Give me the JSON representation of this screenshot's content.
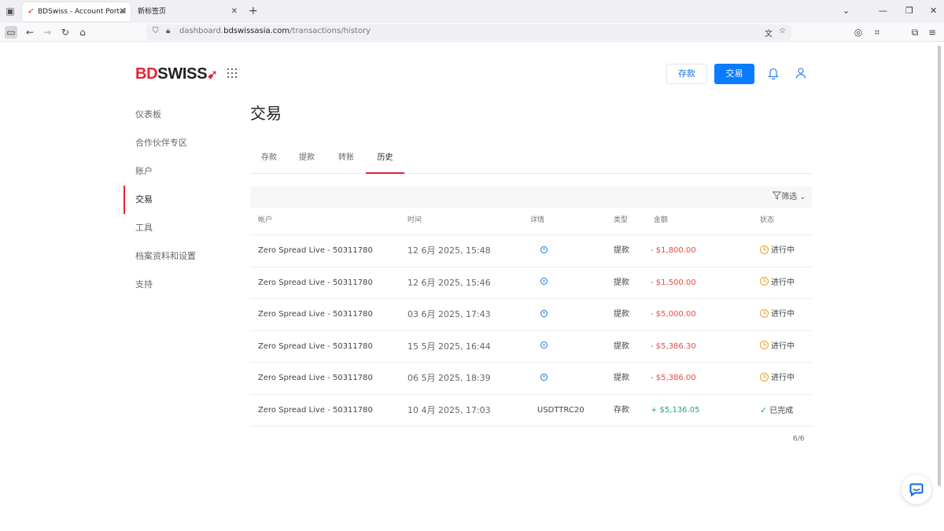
{
  "browser": {
    "tabs": [
      {
        "label": "BDSwiss - Account Portal",
        "active": true
      },
      {
        "label": "新标签页",
        "active": false
      }
    ],
    "url_prefix": "dashboard.",
    "url_domain": "bdswissasia.com",
    "url_path": "/transactions/history"
  },
  "brand": {
    "logo_bd": "BD",
    "logo_swiss": "SWISS",
    "accent_color": "#e52431"
  },
  "header": {
    "deposit_label": "存款",
    "trade_label": "交易"
  },
  "sidebar": {
    "items": [
      {
        "label": "仪表板",
        "active": false
      },
      {
        "label": "合作伙伴专区",
        "active": false
      },
      {
        "label": "账户",
        "active": false
      },
      {
        "label": "交易",
        "active": true
      },
      {
        "label": "工具",
        "active": false
      },
      {
        "label": "档案资料和设置",
        "active": false
      },
      {
        "label": "支持",
        "active": false
      }
    ]
  },
  "main": {
    "title": "交易",
    "tabs": [
      {
        "label": "存款",
        "active": false
      },
      {
        "label": "提款",
        "active": false
      },
      {
        "label": "转账",
        "active": false
      },
      {
        "label": "历史",
        "active": true
      }
    ],
    "filter_label": "筛选",
    "columns": [
      "帐户",
      "时间",
      "详情",
      "类型",
      "金额",
      "状态"
    ],
    "rows": [
      {
        "account": "Zero Spread Live - 50311780",
        "time": "12 6月 2025, 15:48",
        "details": "",
        "type": "提款",
        "amount": "- $1,800.00",
        "sign": "neg",
        "status": "进行中",
        "state": "pending"
      },
      {
        "account": "Zero Spread Live - 50311780",
        "time": "12 6月 2025, 15:46",
        "details": "",
        "type": "提款",
        "amount": "- $1,500.00",
        "sign": "neg",
        "status": "进行中",
        "state": "pending"
      },
      {
        "account": "Zero Spread Live - 50311780",
        "time": "03 6月 2025, 17:43",
        "details": "",
        "type": "提款",
        "amount": "- $5,000.00",
        "sign": "neg",
        "status": "进行中",
        "state": "pending"
      },
      {
        "account": "Zero Spread Live - 50311780",
        "time": "15 5月 2025, 16:44",
        "details": "",
        "type": "提款",
        "amount": "- $5,386.30",
        "sign": "neg",
        "status": "进行中",
        "state": "pending"
      },
      {
        "account": "Zero Spread Live - 50311780",
        "time": "06 5月 2025, 18:39",
        "details": "",
        "type": "提款",
        "amount": "- $5,386.00",
        "sign": "neg",
        "status": "进行中",
        "state": "pending"
      },
      {
        "account": "Zero Spread Live - 50311780",
        "time": "10 4月 2025, 17:03",
        "details": "USDTTRC20",
        "type": "存款",
        "amount": "+ $5,136.05",
        "sign": "pos",
        "status": "已完成",
        "state": "done"
      }
    ],
    "pager": "6/6"
  }
}
